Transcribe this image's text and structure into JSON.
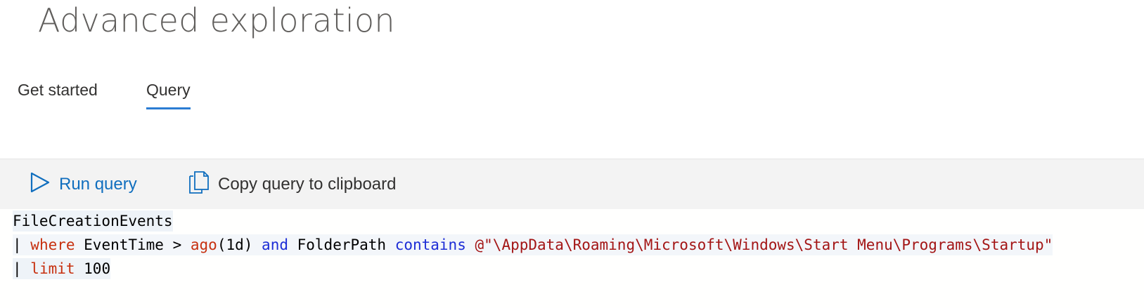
{
  "page": {
    "title": "Advanced exploration"
  },
  "tabs": [
    {
      "label": "Get started",
      "active": false
    },
    {
      "label": "Query",
      "active": true
    }
  ],
  "toolbar": {
    "run_label": "Run query",
    "copy_label": "Copy query to clipboard"
  },
  "editor": {
    "line1": {
      "text": "FileCreationEvents"
    },
    "line2": {
      "pipe": "| ",
      "where": "where",
      "t1": " EventTime > ",
      "ago": "ago",
      "t2": "(1d) ",
      "and": "and",
      "t3": " FolderPath ",
      "contains": "contains",
      "t4": " ",
      "str": "@\"\\AppData\\Roaming\\Microsoft\\Windows\\Start Menu\\Programs\\Startup\""
    },
    "line3": {
      "pipe": "| ",
      "limit": "limit",
      "t1": " 100"
    }
  },
  "colors": {
    "accent": "#2b7cd3",
    "run_text": "#106ebe",
    "keyword_red": "#c7300f",
    "keyword_blue": "#1d2dd6",
    "string": "#a31515"
  },
  "icons": {
    "run": "play-icon",
    "copy": "copy-icon"
  }
}
